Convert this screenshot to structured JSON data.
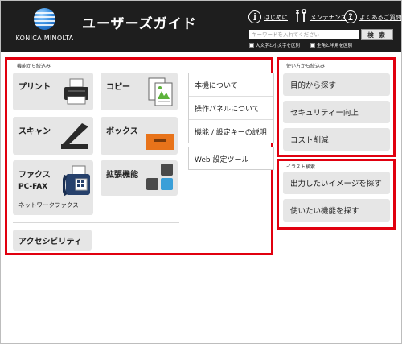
{
  "header": {
    "brand": "KONICA MINOLTA",
    "title": "ユーザーズガイド",
    "links": {
      "intro": "はじめに",
      "maintenance": "メンテナンス",
      "faq": "よくあるご質問"
    },
    "search": {
      "placeholder": "キーワードを入れてください",
      "button": "検 索",
      "option_case": "大文字と小文字を区別",
      "option_width": "全角と半角を区別"
    }
  },
  "function_panel": {
    "label": "機能から絞込み",
    "tiles": {
      "print": "プリント",
      "copy": "コピー",
      "scan": "スキャン",
      "box": "ボックス",
      "fax": "ファクス",
      "pcfax": "PC-FAX",
      "netfax": "ネットワークファクス",
      "extension": "拡張機能",
      "accessibility": "アクセシビリティ"
    },
    "list": [
      "本機について",
      "操作パネルについて",
      "機能 / 設定キーの説明"
    ],
    "web_tool": "Web 設定ツール"
  },
  "usage_panel": {
    "label": "使い方から絞込み",
    "buttons": [
      "目的から探す",
      "セキュリティー向上",
      "コスト削減"
    ]
  },
  "illustration_panel": {
    "label": "イラスト検索",
    "buttons": [
      "出力したいイメージを探す",
      "使いたい機能を探す"
    ]
  },
  "colors": {
    "header_bg": "#1e1e1e",
    "panel_border": "#e1000f",
    "tile_bg": "#e6e6e6",
    "box_orange": "#e8731a",
    "ext_blue": "#3a9fd8"
  }
}
